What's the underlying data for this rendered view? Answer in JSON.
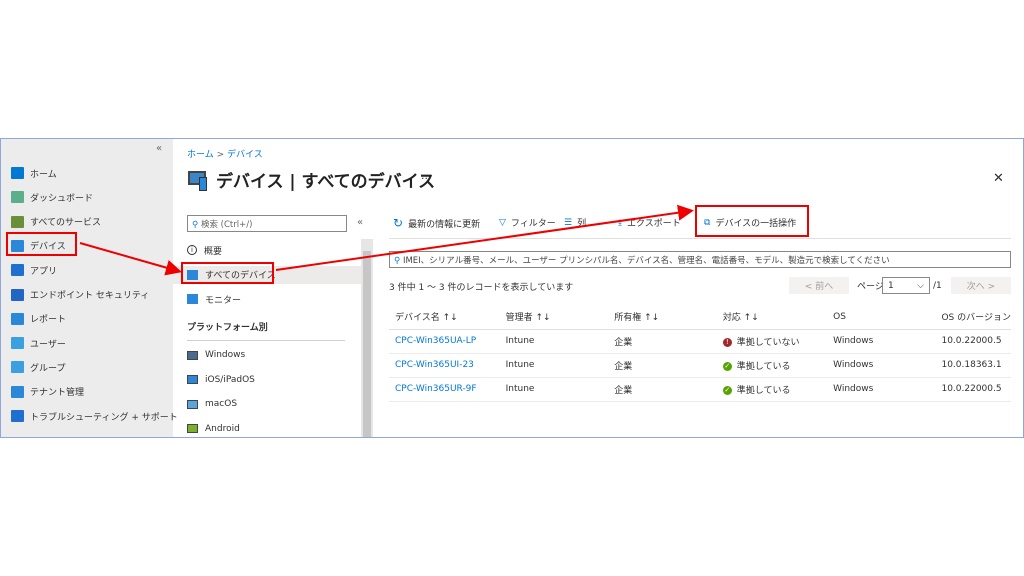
{
  "sidebar": {
    "collapse": "«",
    "items": [
      {
        "label": "ホーム",
        "icon": "home-icon",
        "color": "#0078d4"
      },
      {
        "label": "ダッシュボード",
        "icon": "dashboard-icon",
        "color": "#5caf8a"
      },
      {
        "label": "すべてのサービス",
        "icon": "list-icon",
        "color": "#6a8f3a"
      },
      {
        "label": "デバイス",
        "icon": "device-icon",
        "color": "#2b88d8"
      },
      {
        "label": "アプリ",
        "icon": "apps-icon",
        "color": "#1f6fd0"
      },
      {
        "label": "エンドポイント セキュリティ",
        "icon": "shield-icon",
        "color": "#2166c2"
      },
      {
        "label": "レポート",
        "icon": "report-icon",
        "color": "#2b88d8"
      },
      {
        "label": "ユーザー",
        "icon": "user-icon",
        "color": "#3aa0e0"
      },
      {
        "label": "グループ",
        "icon": "group-icon",
        "color": "#3aa0e0"
      },
      {
        "label": "テナント管理",
        "icon": "tenant-icon",
        "color": "#2b88d8"
      },
      {
        "label": "トラブルシューティング + サポート",
        "icon": "tools-icon",
        "color": "#1f6fd0"
      }
    ]
  },
  "breadcrumb": {
    "home": "ホーム",
    "sep": ">",
    "current": "デバイス"
  },
  "header": {
    "title": "デバイス | すべてのデバイス",
    "more": "···",
    "close": "✕"
  },
  "menu": {
    "search_placeholder": "検索 (Ctrl+/)",
    "collapse": "«",
    "items": [
      {
        "label": "概要"
      },
      {
        "label": "すべてのデバイス"
      },
      {
        "label": "モニター"
      }
    ],
    "section": "プラットフォーム別",
    "platforms": [
      {
        "label": "Windows"
      },
      {
        "label": "iOS/iPadOS"
      },
      {
        "label": "macOS"
      },
      {
        "label": "Android"
      }
    ]
  },
  "toolbar": {
    "refresh": "最新の情報に更新",
    "filter": "フィルター",
    "columns": "列",
    "export": "エクスポート",
    "bulk": "デバイスの一括操作"
  },
  "filter_placeholder": "IMEI、シリアル番号、メール、ユーザー プリンシパル名、デバイス名、管理名、電話番号、モデル、製造元で検索してください",
  "records": "3 件中 1 ～ 3 件のレコードを表示しています",
  "pager": {
    "prev": "< 前へ",
    "page_label": "ページ",
    "page": "1",
    "total": "/1",
    "next": "次へ >"
  },
  "table": {
    "headers": [
      "デバイス名 ↑↓",
      "管理者 ↑↓",
      "所有権 ↑↓",
      "対応 ↑↓",
      "OS",
      "OS のバージョン"
    ],
    "rows": [
      {
        "name": "CPC-Win365UA-LP",
        "admin": "Intune",
        "owner": "企業",
        "status": "準拠していない",
        "ok": false,
        "os": "Windows",
        "ver": "10.0.22000.5"
      },
      {
        "name": "CPC-Win365UI-23",
        "admin": "Intune",
        "owner": "企業",
        "status": "準拠している",
        "ok": true,
        "os": "Windows",
        "ver": "10.0.18363.1"
      },
      {
        "name": "CPC-Win365UR-9F",
        "admin": "Intune",
        "owner": "企業",
        "status": "準拠している",
        "ok": true,
        "os": "Windows",
        "ver": "10.0.22000.5"
      }
    ]
  }
}
